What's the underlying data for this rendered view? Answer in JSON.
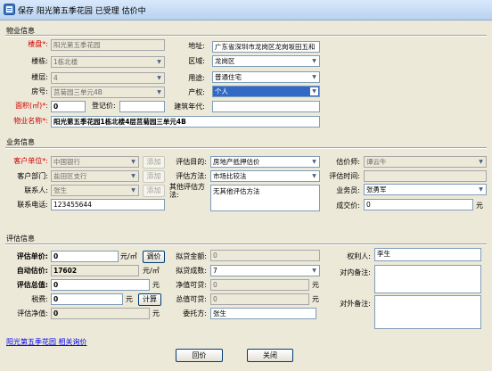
{
  "window": {
    "title": "保存 阳光第五季花园 已受理   估价中"
  },
  "property_info": {
    "section_title": "物业信息",
    "estate_label": "楼盘*:",
    "estate_value": "阳光第五季花园",
    "building_label": "楼栋:",
    "building_value": "1栋北楼",
    "floor_label": "楼层:",
    "floor_value": "4",
    "room_label": "房号:",
    "room_value": "莒菊园三单元4B",
    "area_label": "面积(㎡)*:",
    "area_value": "0",
    "reg_price_label": "登记价:",
    "reg_price_value": "",
    "name_label": "物业名称*:",
    "name_value": "阳光第五季花园1栋北楼4层莒菊园三单元4B",
    "address_label": "地址:",
    "address_value": "广东省深圳市龙岗区龙岗坂田五和",
    "district_label": "区域:",
    "district_value": "龙岗区",
    "usage_label": "用途:",
    "usage_value": "普通住宅",
    "ownership_label": "产权:",
    "ownership_value": "个人",
    "build_year_label": "建筑年代:",
    "build_year_value": ""
  },
  "business_info": {
    "section_title": "业务信息",
    "client_unit_label": "客户单位*:",
    "client_unit_value": "中国银行",
    "client_dept_label": "客户部门:",
    "client_dept_value": "盐田区支行",
    "contact_label": "联系人:",
    "contact_value": "张生",
    "phone_label": "联系电话:",
    "phone_value": "123455644",
    "add_label": "添加",
    "purpose_label": "评估目的:",
    "purpose_value": "房地产抵押估价",
    "method_label": "评估方法:",
    "method_value": "市场比较法",
    "other_method_label": "其他评估方法:",
    "other_method_value": "无其他评估方法",
    "appraiser_label": "估价师:",
    "appraiser_value": "谭云牛",
    "appraise_time_label": "评估时间:",
    "appraise_time_value": "",
    "salesman_label": "业务员:",
    "salesman_value": "张勇军",
    "deal_price_label": "成交价:",
    "deal_price_value": "0",
    "deal_price_unit": "元"
  },
  "appraisal_info": {
    "section_title": "评估信息",
    "unit_price_label": "评估单价:",
    "unit_price_value": "0",
    "unit_price_unit": "元/㎡",
    "adjust_label": "调价",
    "auto_price_label": "自动估价:",
    "auto_price_value": "17602",
    "auto_price_unit": "元/㎡",
    "total_label": "评估总值:",
    "total_value": "0",
    "total_unit": "元",
    "tax_label": "税费:",
    "tax_value": "0",
    "tax_unit": "元",
    "calc_label": "计算",
    "net_label": "评估净值:",
    "net_value": "0",
    "net_unit": "元",
    "loan_amount_label": "拟贷金额:",
    "loan_amount_value": "0",
    "loan_ratio_label": "拟贷成数:",
    "loan_ratio_value": "7",
    "net_loanable_label": "净值可贷:",
    "net_loanable_value": "0",
    "net_loanable_unit": "元",
    "total_loanable_label": "总值可贷:",
    "total_loanable_value": "0",
    "total_loanable_unit": "元",
    "client_label": "委托方:",
    "client_value": "张生",
    "owner_label": "权利人:",
    "owner_value": "李生",
    "internal_note_label": "对内备注:",
    "external_note_label": "对外备注:"
  },
  "footer": {
    "link_label": "阳光第五季花园 相关询价",
    "reply_label": "回价",
    "close_label": "关闭"
  },
  "colors": {
    "required": "#d00000",
    "link": "#0000ee",
    "window_bg": "#ece9d8"
  }
}
